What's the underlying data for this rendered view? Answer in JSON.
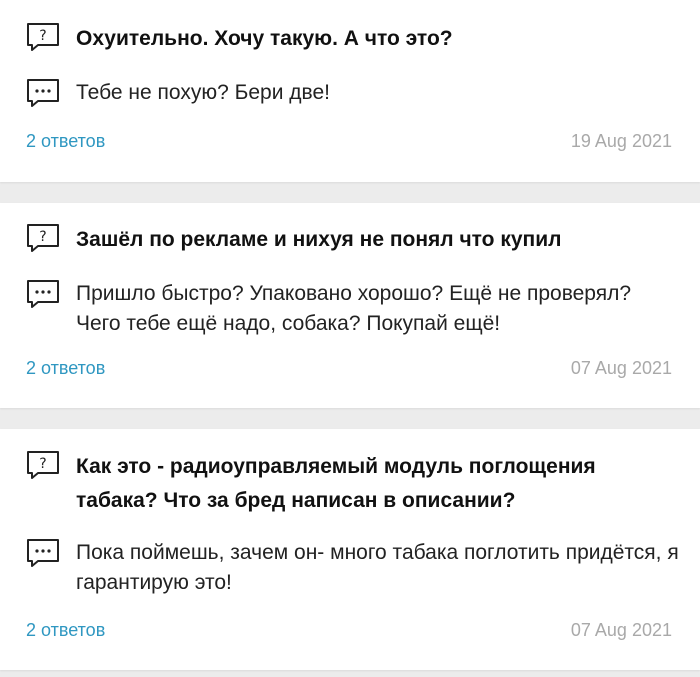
{
  "questions": [
    {
      "question": "Охуительно. Хочу такую. А что это?",
      "answer": "Тебе не похую? Бери две!",
      "answers_link": "2 ответов",
      "date": "19 Aug 2021"
    },
    {
      "question": "Зашёл по рекламе и нихуя не понял что купил",
      "answer": "Пришло быстро? Упаковано хорошо? Ещё не проверял? Чего тебе ещё надо, собака? Покупай ещё!",
      "answers_link": "2 ответов",
      "date": "07 Aug 2021"
    },
    {
      "question": "Как это - радиоуправляемый модуль поглощения табака? Что за бред написан в описании?",
      "answer": "Пока поймешь, зачем он- много табака поглотить придётся, я гарантирую это!",
      "answers_link": "2 ответов",
      "date": "07 Aug 2021"
    }
  ],
  "icons": {
    "question": "question-bubble-icon",
    "answer": "ellipsis-bubble-icon"
  },
  "colors": {
    "link": "#2f97c1",
    "date": "#a9a9a9",
    "background": "#ececec"
  }
}
